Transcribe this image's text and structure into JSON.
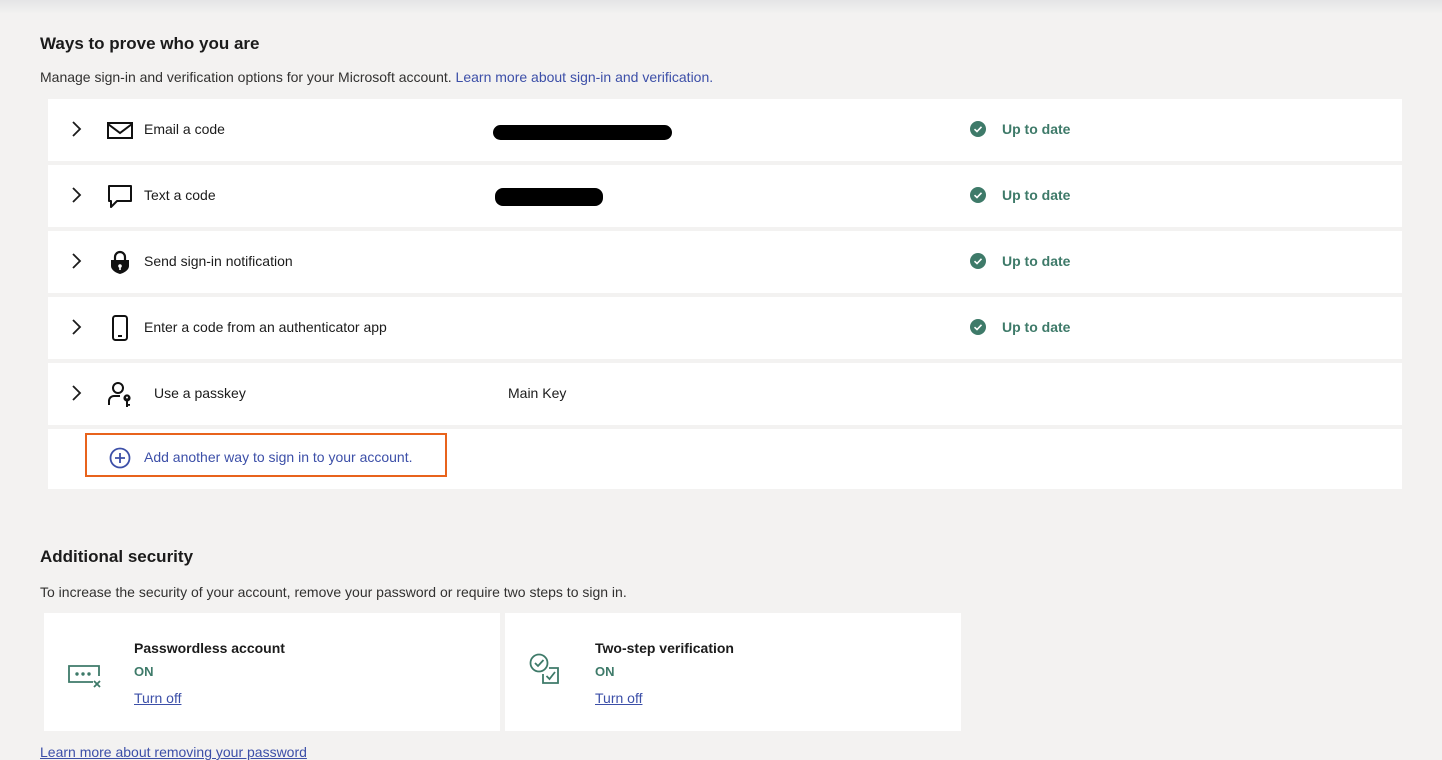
{
  "ways": {
    "title": "Ways to prove who you are",
    "description": "Manage sign-in and verification options for your Microsoft account.",
    "learn_more": "Learn more about sign-in and verification.",
    "methods": [
      {
        "label": "Email a code",
        "value": "",
        "status": "Up to date",
        "icon": "envelope-icon"
      },
      {
        "label": "Text a code",
        "value": "",
        "status": "Up to date",
        "icon": "chat-bubble-icon"
      },
      {
        "label": "Send sign-in notification",
        "value": "",
        "status": "Up to date",
        "icon": "lock-shield-icon"
      },
      {
        "label": "Enter a code from an authenticator app",
        "value": "",
        "status": "Up to date",
        "icon": "phone-icon"
      },
      {
        "label": "Use a passkey",
        "value": "Main Key",
        "status": "",
        "icon": "person-key-icon"
      }
    ],
    "add_label": "Add another way to sign in to your account."
  },
  "additional": {
    "title": "Additional security",
    "description": "To increase the security of your account, remove your password or require two steps to sign in.",
    "cards": [
      {
        "title": "Passwordless account",
        "state": "ON",
        "action": "Turn off",
        "icon": "password-x-icon"
      },
      {
        "title": "Two-step verification",
        "state": "ON",
        "action": "Turn off",
        "icon": "double-check-icon"
      }
    ],
    "footer_link": "Learn more about removing your password"
  },
  "colors": {
    "accent": "#3c4fa8",
    "status": "#3e7a69",
    "highlight": "#e8631c"
  }
}
